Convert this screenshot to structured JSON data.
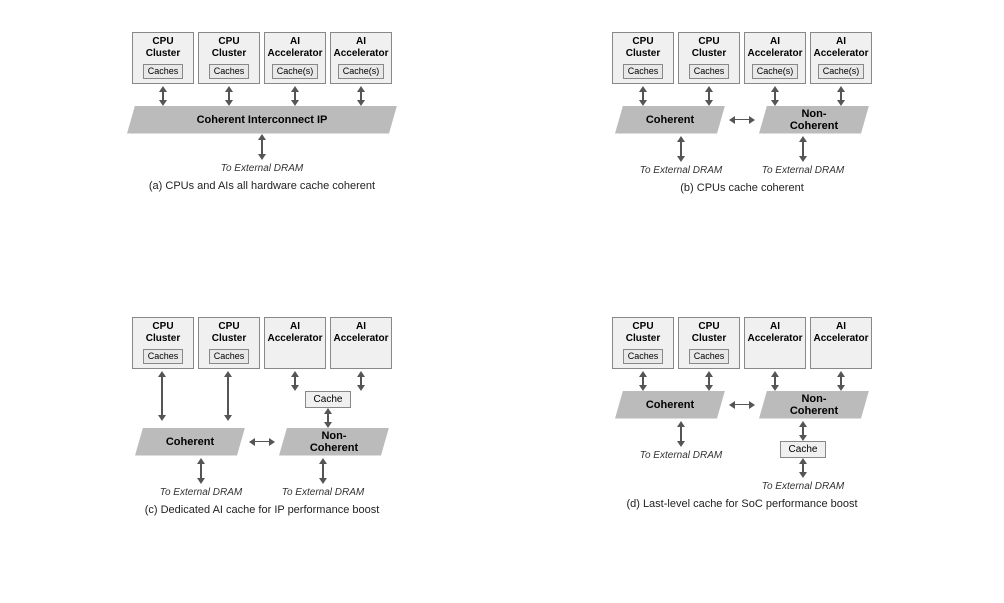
{
  "diagrams": [
    {
      "id": "a",
      "caption": "(a) CPUs and AIs all hardware cache coherent",
      "units": [
        {
          "title": "CPU\nCluster",
          "sub": "Caches"
        },
        {
          "title": "CPU\nCluster",
          "sub": "Caches"
        },
        {
          "title": "AI\nAccelerator",
          "sub": "Cache(s)"
        },
        {
          "title": "AI\nAccelerator",
          "sub": "Cache(s)"
        }
      ],
      "layout": "single-banner",
      "banner": "Coherent Interconnect IP",
      "dram": [
        "To External DRAM"
      ]
    },
    {
      "id": "b",
      "caption": "(b) CPUs cache coherent",
      "units": [
        {
          "title": "CPU\nCluster",
          "sub": "Caches"
        },
        {
          "title": "CPU\nCluster",
          "sub": "Caches"
        },
        {
          "title": "AI\nAccelerator",
          "sub": "Cache(s)"
        },
        {
          "title": "AI\nAccelerator",
          "sub": "Cache(s)"
        }
      ],
      "layout": "dual-banner",
      "banner1": "Coherent",
      "banner2": "Non-Coherent",
      "dram": [
        "To External DRAM",
        "To External DRAM"
      ]
    },
    {
      "id": "c",
      "caption": "(c) Dedicated AI cache for IP performance boost",
      "units": [
        {
          "title": "CPU\nCluster",
          "sub": "Caches"
        },
        {
          "title": "CPU\nCluster",
          "sub": "Caches"
        },
        {
          "title": "AI\nAccelerator",
          "sub": null
        },
        {
          "title": "AI\nAccelerator",
          "sub": null
        }
      ],
      "layout": "dual-banner-cache",
      "banner1": "Coherent",
      "banner2": "Non-Coherent",
      "cache_label": "Cache",
      "dram": [
        "To External DRAM",
        "To External DRAM"
      ]
    },
    {
      "id": "d",
      "caption": "(d) Last-level cache for SoC performance boost",
      "units": [
        {
          "title": "CPU\nCluster",
          "sub": "Caches"
        },
        {
          "title": "CPU\nCluster",
          "sub": "Caches"
        },
        {
          "title": "AI\nAccelerator",
          "sub": null
        },
        {
          "title": "AI\nAccelerator",
          "sub": null
        }
      ],
      "layout": "dual-banner-cache-bottom",
      "banner1": "Coherent",
      "banner2": "Non-Coherent",
      "cache_label": "Cache",
      "dram": [
        "To External DRAM",
        "To External DRAM"
      ]
    }
  ]
}
